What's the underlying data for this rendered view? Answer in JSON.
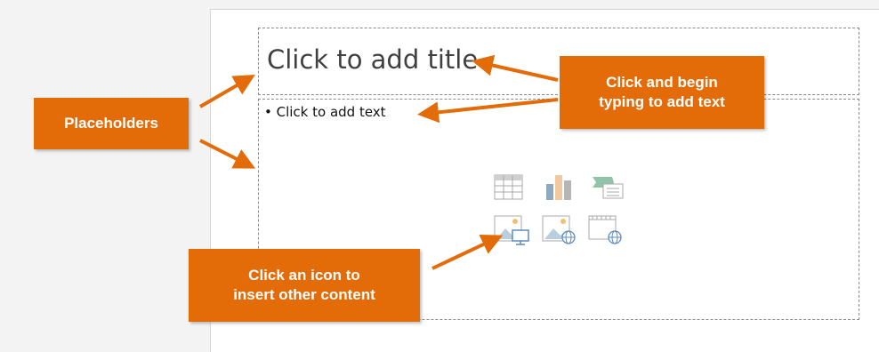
{
  "slide": {
    "title_placeholder": "Click to add title",
    "content_placeholder_bullet": "• Click to add text"
  },
  "callouts": {
    "placeholders": "Placeholders",
    "typing_line1": "Click and begin",
    "typing_line2": "typing to add text",
    "icon_line1": "Click an icon to",
    "icon_line2": "insert other content"
  },
  "content_icons": [
    {
      "name": "insert-table-icon"
    },
    {
      "name": "insert-chart-icon"
    },
    {
      "name": "insert-smartart-icon"
    },
    {
      "name": "insert-picture-icon"
    },
    {
      "name": "insert-online-picture-icon"
    },
    {
      "name": "insert-video-icon"
    }
  ],
  "colors": {
    "callout": "#e36c09",
    "arrow": "#e36c09"
  }
}
